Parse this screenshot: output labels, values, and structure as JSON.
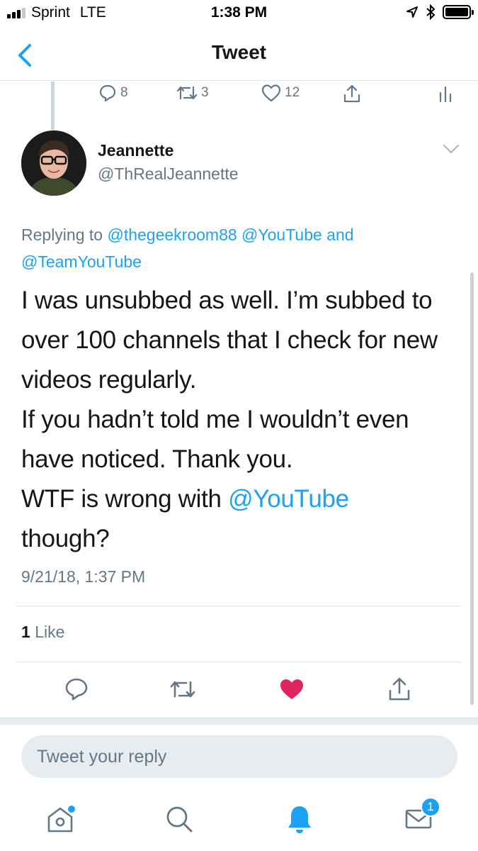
{
  "status_bar": {
    "carrier": "Sprint",
    "network": "LTE",
    "time": "1:38 PM"
  },
  "nav": {
    "title": "Tweet",
    "back_icon": "chevron-left-icon"
  },
  "previous_tweet_actions": {
    "reply_count": "8",
    "retweet_count": "3",
    "like_count": "12"
  },
  "tweet": {
    "author_name": "Jeannette",
    "author_handle": "@ThRealJeannette",
    "replying_prefix": "Replying to",
    "replying_to": [
      "@thegeekroom88",
      "@YouTube",
      "@TeamYouTube"
    ],
    "replying_and": "and",
    "text_parts": {
      "p1": "I was unsubbed as well. I’m subbed to over 100 channels that I check for new videos regularly.",
      "p2": "If you hadn’t told me I wouldn’t even have noticed. Thank you.",
      "p3_before": "WTF is wrong with ",
      "p3_mention": "@YouTube",
      "p3_after": "though?"
    },
    "timestamp": "9/21/18, 1:37 PM",
    "like_count": "1",
    "like_label": "Like",
    "liked": true
  },
  "reply": {
    "placeholder": "Tweet your reply",
    "value": ""
  },
  "tabbar": {
    "messages_badge": "1"
  },
  "colors": {
    "accent": "#1da1f2",
    "like": "#e0245e",
    "muted": "#657786",
    "text": "#14171a"
  }
}
